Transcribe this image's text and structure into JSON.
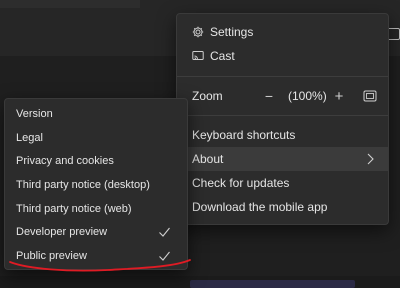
{
  "menu": {
    "settings": "Settings",
    "cast": "Cast",
    "zoom_label": "Zoom",
    "zoom_minus": "−",
    "zoom_value": "(100%)",
    "zoom_plus": "+",
    "keyboard_shortcuts": "Keyboard shortcuts",
    "about": "About",
    "check_updates": "Check for updates",
    "download_app": "Download the mobile app"
  },
  "submenu": {
    "items": [
      {
        "label": "Version",
        "checked": false
      },
      {
        "label": "Legal",
        "checked": false
      },
      {
        "label": "Privacy and cookies",
        "checked": false
      },
      {
        "label": "Third party notice (desktop)",
        "checked": false
      },
      {
        "label": "Third party notice (web)",
        "checked": false
      },
      {
        "label": "Developer preview",
        "checked": true
      },
      {
        "label": "Public preview",
        "checked": true
      }
    ]
  },
  "colors": {
    "menu_bg": "#2c2c2c",
    "active_bg": "#3b3b3b",
    "annotation_red": "#e01b24"
  },
  "icons": {
    "settings": "gear-icon",
    "cast": "cast-icon",
    "zoom_fit": "fullscreen-icon",
    "about_chevron": "chevron-right-icon",
    "checkmark": "checkmark-icon"
  }
}
